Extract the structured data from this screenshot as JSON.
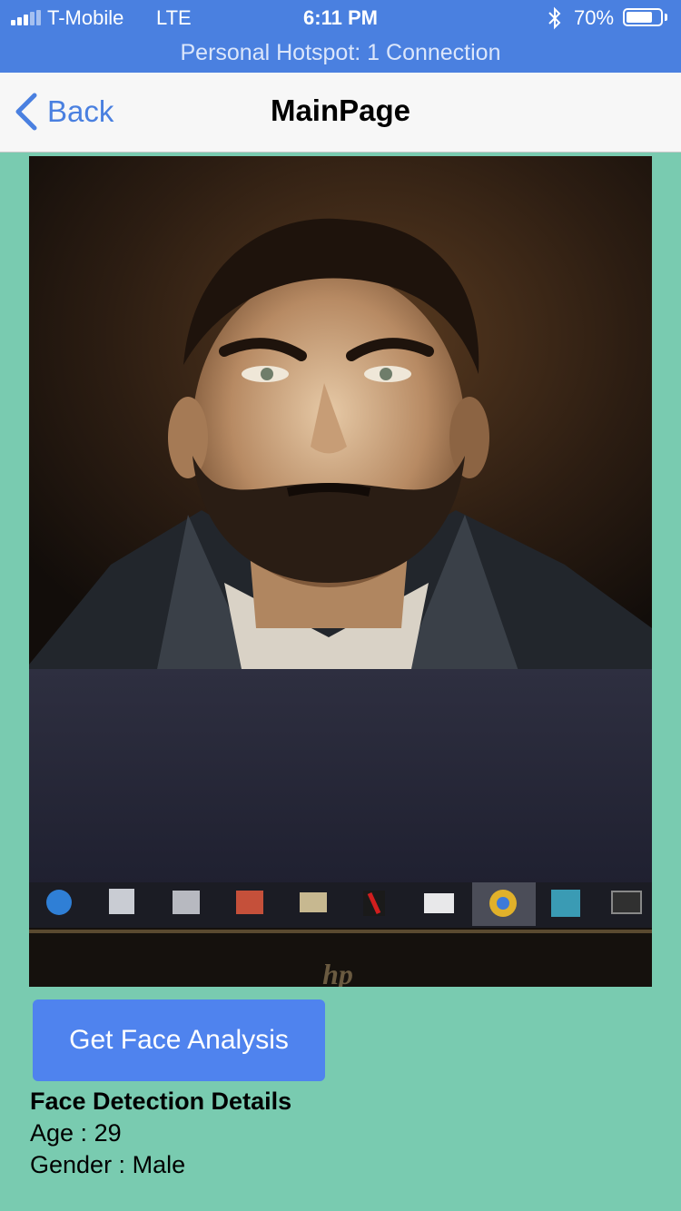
{
  "status_bar": {
    "carrier": "T-Mobile",
    "network": "LTE",
    "time": "6:11 PM",
    "battery_percent": "70%",
    "battery_level": 0.7,
    "hotspot": "Personal Hotspot: 1 Connection"
  },
  "nav": {
    "back_label": "Back",
    "title": "MainPage"
  },
  "photo": {
    "description_icon": "portrait-photo-of-laptop-screen",
    "logo_text": "hp"
  },
  "actions": {
    "analyze_label": "Get Face Analysis"
  },
  "details": {
    "heading": "Face Detection Details",
    "age_label": "Age :",
    "age_value": "29",
    "gender_label": "Gender :",
    "gender_value": "Male"
  },
  "colors": {
    "status_bar": "#4a80e0",
    "background": "#79cbb0",
    "button": "#4f83ee",
    "accent": "#4a80e0"
  }
}
